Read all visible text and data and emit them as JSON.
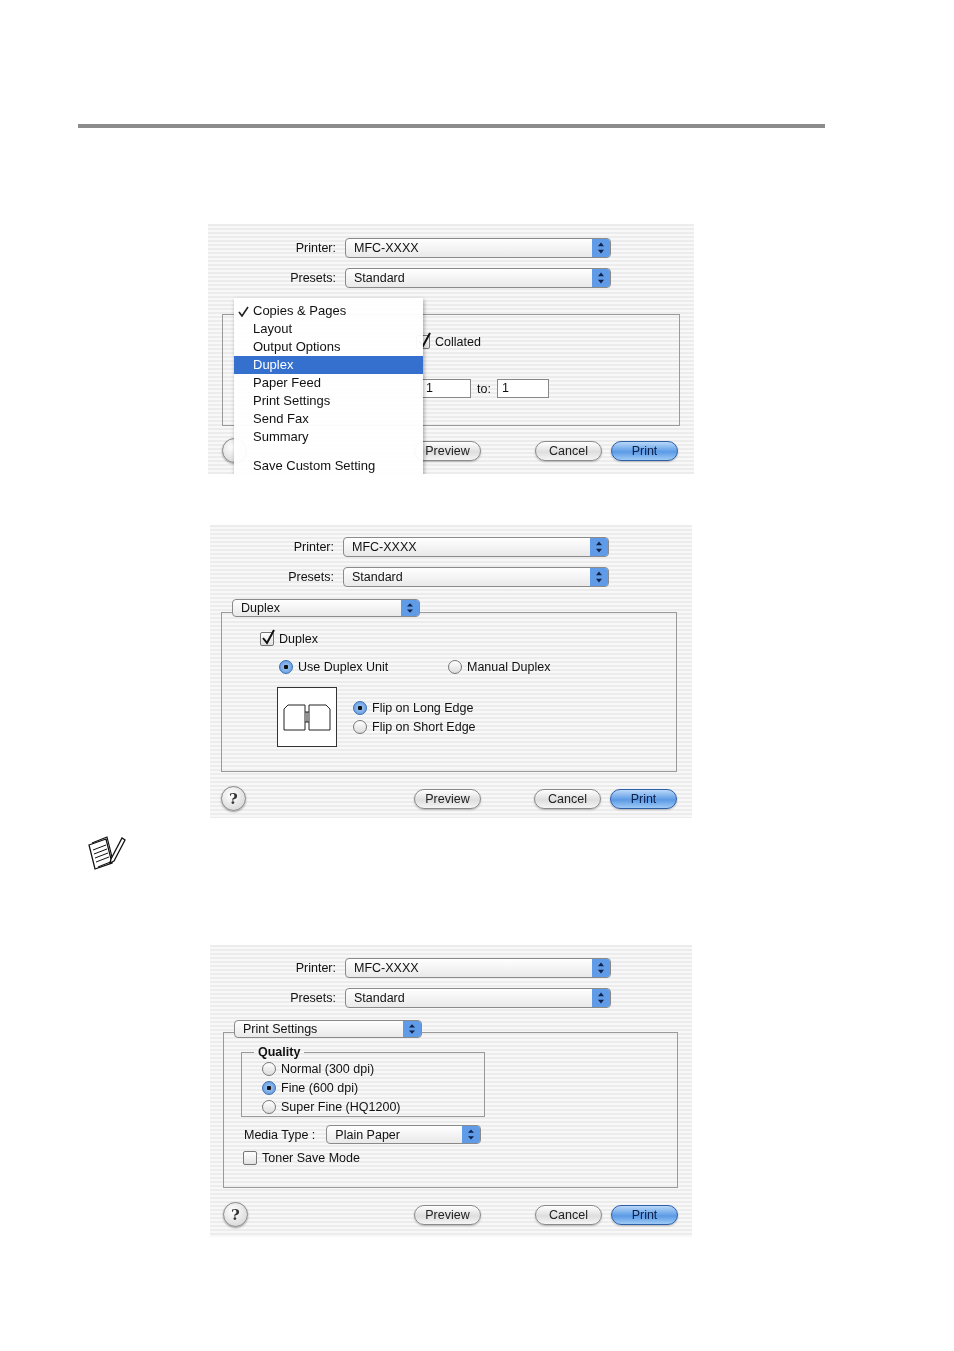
{
  "dialogs": [
    {
      "kind": "copies",
      "printer": {
        "label": "Printer:",
        "value": "MFC-XXXX"
      },
      "presets": {
        "label": "Presets:",
        "value": "Standard"
      },
      "menu": {
        "items": [
          {
            "label": "Copies & Pages",
            "checked": true,
            "selected": false
          },
          {
            "label": "Layout",
            "checked": false,
            "selected": false
          },
          {
            "label": "Output Options",
            "checked": false,
            "selected": false
          },
          {
            "label": "Duplex",
            "checked": false,
            "selected": true
          },
          {
            "label": "Paper Feed",
            "checked": false,
            "selected": false
          },
          {
            "label": "Print Settings",
            "checked": false,
            "selected": false
          },
          {
            "label": "Send Fax",
            "checked": false,
            "selected": false
          },
          {
            "label": "Summary",
            "checked": false,
            "selected": false
          }
        ],
        "footer": "Save Custom Setting"
      },
      "collated": {
        "label": "Collated",
        "checked": true
      },
      "from_value": "1",
      "to_label": "to:",
      "to_value": "1",
      "buttons": [
        {
          "label": "Preview",
          "default": false
        },
        {
          "label": "Cancel",
          "default": false
        },
        {
          "label": "Print",
          "default": true
        }
      ]
    },
    {
      "kind": "duplex",
      "printer": {
        "label": "Printer:",
        "value": "MFC-XXXX"
      },
      "presets": {
        "label": "Presets:",
        "value": "Standard"
      },
      "pane": "Duplex",
      "duplex": {
        "label": "Duplex",
        "checked": true
      },
      "modes": [
        {
          "label": "Use Duplex Unit",
          "selected": true
        },
        {
          "label": "Manual Duplex",
          "selected": false
        }
      ],
      "binding": [
        {
          "label": "Flip on Long Edge",
          "selected": true
        },
        {
          "label": "Flip on Short Edge",
          "selected": false
        }
      ],
      "help": "?",
      "buttons": [
        {
          "label": "Preview",
          "default": false
        },
        {
          "label": "Cancel",
          "default": false
        },
        {
          "label": "Print",
          "default": true
        }
      ]
    },
    {
      "kind": "print_settings",
      "printer": {
        "label": "Printer:",
        "value": "MFC-XXXX"
      },
      "presets": {
        "label": "Presets:",
        "value": "Standard"
      },
      "pane": "Print Settings",
      "quality": {
        "title": "Quality",
        "options": [
          {
            "label": "Normal (300 dpi)",
            "selected": false
          },
          {
            "label": "Fine (600 dpi)",
            "selected": true
          },
          {
            "label": "Super Fine (HQ1200)",
            "selected": false
          }
        ]
      },
      "media_type": {
        "label": "Media Type :",
        "value": "Plain Paper"
      },
      "toner_save": {
        "label": "Toner Save Mode",
        "checked": false
      },
      "help": "?",
      "buttons": [
        {
          "label": "Preview",
          "default": false
        },
        {
          "label": "Cancel",
          "default": false
        },
        {
          "label": "Print",
          "default": true
        }
      ]
    }
  ]
}
